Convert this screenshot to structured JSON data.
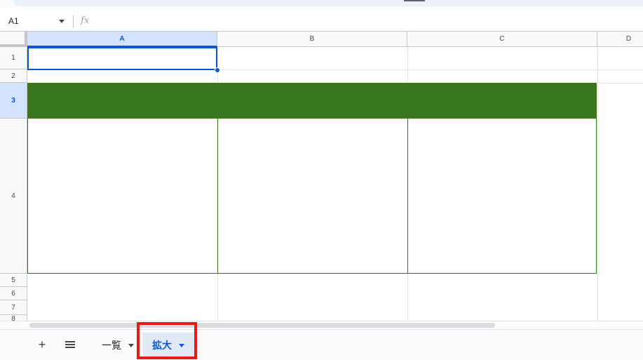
{
  "formula_bar": {
    "cell_reference": "A1",
    "fx_label": "fx"
  },
  "grid": {
    "columns": [
      "A",
      "B",
      "C",
      "D"
    ],
    "rows": [
      "1",
      "2",
      "3",
      "4",
      "5",
      "6",
      "7",
      "8"
    ],
    "selected_column": "A",
    "selected_row": "3",
    "selected_cell": "A1"
  },
  "sheet_tabs": {
    "tabs": [
      {
        "label": "一覧",
        "active": false
      },
      {
        "label": "拡大",
        "active": true
      }
    ]
  },
  "colors": {
    "header_band": "#38761d",
    "selection": "#0b57d0",
    "highlight": "#e21b1b"
  },
  "icons": {
    "add_sheet": "plus-icon",
    "all_sheets": "menu-icon",
    "dropdown": "caret-down-icon"
  }
}
